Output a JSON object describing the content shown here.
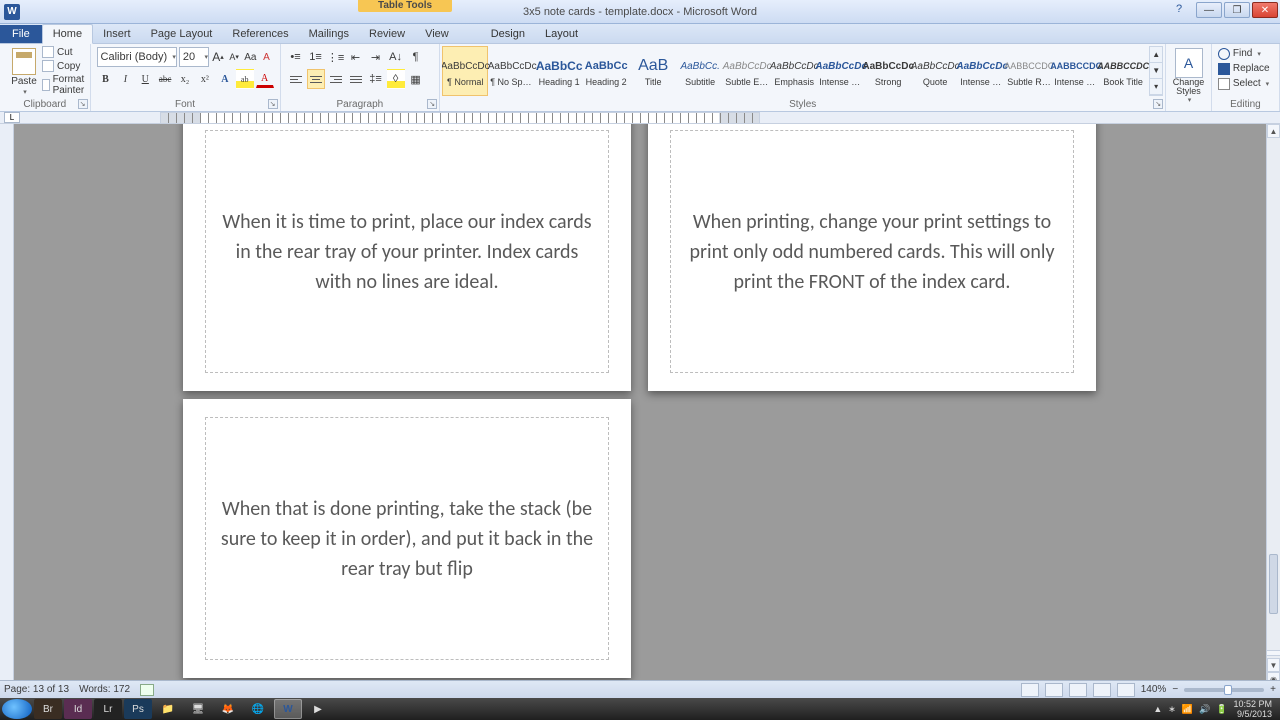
{
  "titlebar": {
    "app_icon_letter": "W",
    "table_tools_label": "Table Tools",
    "doc_title": "3x5 note cards - template.docx - Microsoft Word",
    "help": "?",
    "btn_min": "—",
    "btn_max": "❐",
    "btn_close": "✕"
  },
  "tabs": {
    "file": "File",
    "items": [
      "Home",
      "Insert",
      "Page Layout",
      "References",
      "Mailings",
      "Review",
      "View"
    ],
    "tool_tabs": [
      "Design",
      "Layout"
    ],
    "active": "Home"
  },
  "ribbon": {
    "clipboard": {
      "label": "Clipboard",
      "paste": "Paste",
      "cut": "Cut",
      "copy": "Copy",
      "format_painter": "Format Painter"
    },
    "font": {
      "label": "Font",
      "name": "Calibri (Body)",
      "size": "20",
      "grow": "A",
      "shrink": "A",
      "case": "Aa",
      "clear": "⌫",
      "bold": "B",
      "italic": "I",
      "underline": "U",
      "strike": "abc",
      "sub": "x₂",
      "sup": "x²",
      "effects": "A",
      "highlight": "ab",
      "color": "A"
    },
    "paragraph": {
      "label": "Paragraph"
    },
    "styles": {
      "label": "Styles",
      "items": [
        {
          "preview": "AaBbCcDc",
          "name": "¶ Normal",
          "active": true,
          "css": "font-size:10px;"
        },
        {
          "preview": "AaBbCcDc",
          "name": "¶ No Spaci...",
          "css": "font-size:10px;"
        },
        {
          "preview": "AaBbCc",
          "name": "Heading 1",
          "css": "font-size:12px;color:#2b579a;font-weight:bold;"
        },
        {
          "preview": "AaBbCc",
          "name": "Heading 2",
          "css": "font-size:11px;color:#2b579a;font-weight:bold;"
        },
        {
          "preview": "AaB",
          "name": "Title",
          "css": "font-size:16px;color:#2b579a;"
        },
        {
          "preview": "AaBbCc.",
          "name": "Subtitle",
          "css": "font-size:10px;color:#2b579a;font-style:italic;"
        },
        {
          "preview": "AaBbCcDc",
          "name": "Subtle Em...",
          "css": "font-size:10px;color:#888;font-style:italic;"
        },
        {
          "preview": "AaBbCcDc",
          "name": "Emphasis",
          "css": "font-size:10px;font-style:italic;"
        },
        {
          "preview": "AaBbCcDc",
          "name": "Intense E...",
          "css": "font-size:10px;color:#2b579a;font-style:italic;font-weight:bold;"
        },
        {
          "preview": "AaBbCcDc",
          "name": "Strong",
          "css": "font-size:10px;font-weight:bold;"
        },
        {
          "preview": "AaBbCcDc",
          "name": "Quote",
          "css": "font-size:10px;font-style:italic;"
        },
        {
          "preview": "AaBbCcDc",
          "name": "Intense Q...",
          "css": "font-size:10px;color:#2b579a;font-style:italic;font-weight:bold;"
        },
        {
          "preview": "AABBCCDC",
          "name": "Subtle Ref...",
          "css": "font-size:9px;color:#888;"
        },
        {
          "preview": "AABBCCDC",
          "name": "Intense Re...",
          "css": "font-size:9px;color:#2b579a;font-weight:bold;"
        },
        {
          "preview": "AABBCCDC",
          "name": "Book Title",
          "css": "font-size:9px;font-weight:bold;font-style:italic;"
        }
      ],
      "change_styles": "Change Styles"
    },
    "editing": {
      "label": "Editing",
      "find": "Find",
      "replace": "Replace",
      "select": "Select"
    }
  },
  "cards": {
    "c1": "When it is time to print, place our index cards in the rear tray of your printer.  Index cards with no lines are ideal.",
    "c2": "When printing, change your print settings to print only odd numbered cards.  This will only print the FRONT of the index card.",
    "c3": "When that is done printing, take the stack (be sure to keep it in order), and put it back in the rear tray but flip"
  },
  "status": {
    "page": "Page: 13 of 13",
    "words": "Words: 172",
    "zoom": "140%",
    "minus": "−",
    "plus": "+"
  },
  "tray": {
    "time": "10:52 PM",
    "date": "9/5/2013"
  }
}
